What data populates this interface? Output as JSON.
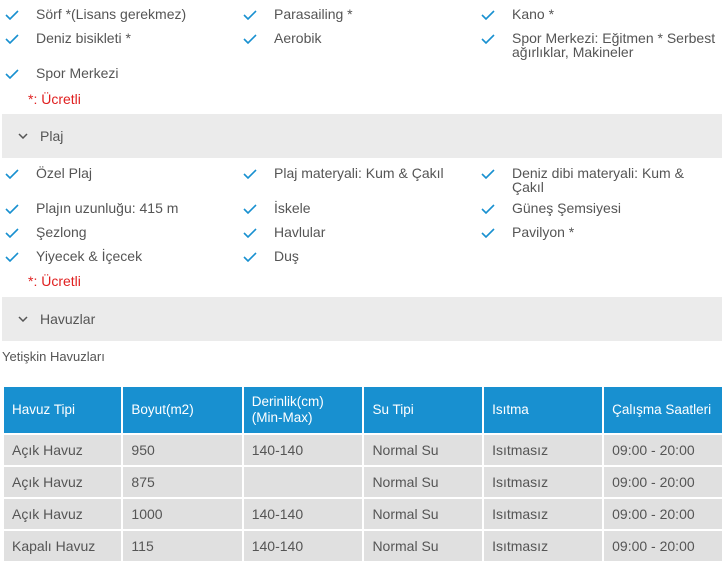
{
  "icons": {
    "check": "checkmark-icon",
    "chevron": "chevron-down-icon"
  },
  "colors": {
    "accent": "#1890d0",
    "paid": "#e02020",
    "section_bg": "#ebebeb"
  },
  "sport": {
    "items": [
      "Sörf *(Lisans gerekmez)",
      "Parasailing *",
      "Kano *",
      "Deniz bisikleti *",
      "Aerobik",
      "Spor Merkezi: Eğitmen * Serbest ağırlıklar, Makineler",
      "Spor Merkezi"
    ],
    "note_star": "*:",
    "note_text": " Ücretli"
  },
  "beach": {
    "title": "Plaj",
    "items": [
      "Özel Plaj",
      "Plaj materyali: Kum & Çakıl",
      "Deniz dibi materyali: Kum & Çakıl",
      "Plajın uzunluğu: 415 m",
      "İskele",
      "Güneş Şemsiyesi",
      "Şezlong",
      "Havlular",
      "Pavilyon *",
      "Yiyecek & İçecek",
      "Duş"
    ],
    "note_star": "*:",
    "note_text": " Ücretli"
  },
  "pools": {
    "title": "Havuzlar",
    "subtitle": "Yetişkin Havuzları",
    "headers": [
      "Havuz Tipi",
      "Boyut(m2)",
      "Derinlik(cm) (Min-Max)",
      "Su Tipi",
      "Isıtma",
      "Çalışma Saatleri"
    ],
    "rows": [
      [
        "Açık Havuz",
        "950",
        "140-140",
        "Normal Su",
        "Isıtmasız",
        "09:00 - 20:00"
      ],
      [
        "Açık Havuz",
        "875",
        "",
        "Normal Su",
        "Isıtmasız",
        "09:00 - 20:00"
      ],
      [
        "Açık Havuz",
        "1000",
        "140-140",
        "Normal Su",
        "Isıtmasız",
        "09:00 - 20:00"
      ],
      [
        "Kapalı Havuz",
        "115",
        "140-140",
        "Normal Su",
        "Isıtmasız",
        "09:00 - 20:00"
      ]
    ]
  }
}
